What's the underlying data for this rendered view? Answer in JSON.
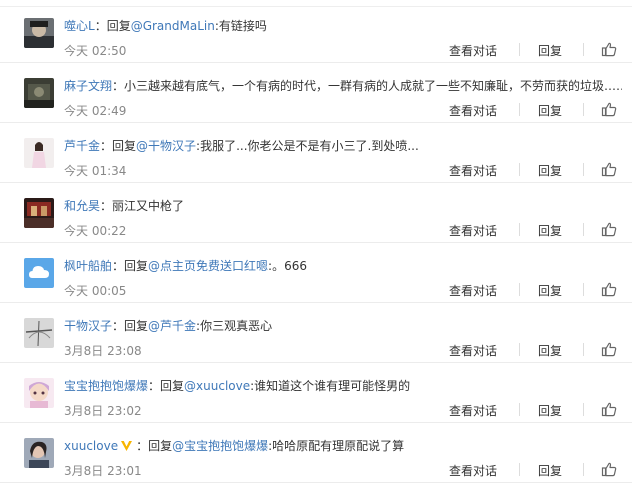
{
  "actions": {
    "view_conversation": "查看对话",
    "reply": "回复"
  },
  "comments": [
    {
      "user": "噬心L",
      "prefix": "：回复",
      "reply_to": "@GrandMaLin",
      "text": ":有链接吗",
      "time": "今天 02:50",
      "avatar": "dark-portrait-avatar"
    },
    {
      "user": "麻子文翔",
      "prefix": "",
      "reply_to": "",
      "text": "：小三越来越有底气，一个有病的时代，一群有病的人成就了一些不知廉耻，不劳而获的垃圾……",
      "time": "今天 02:49",
      "avatar": "dark-scene-avatar"
    },
    {
      "user": "芦千金",
      "prefix": "：回复",
      "reply_to": "@干物汉子",
      "text": ":我服了...你老公是不是有小三了.到处喷...",
      "time": "今天 01:34",
      "avatar": "girl-portrait-avatar"
    },
    {
      "user": "和允昊",
      "prefix": "",
      "reply_to": "",
      "text": "：丽江又中枪了",
      "time": "今天 00:22",
      "avatar": "red-scene-avatar"
    },
    {
      "user": "枫叶船舶",
      "prefix": "：回复",
      "reply_to": "@点主页免费送口红嗯",
      "text": ":。666",
      "time": "今天 00:05",
      "avatar": "default-cloud-avatar"
    },
    {
      "user": "干物汉子",
      "prefix": "：回复",
      "reply_to": "@芦千金",
      "text": ":你三观真恶心",
      "time": "3月8日 23:08",
      "avatar": "gray-sketch-avatar"
    },
    {
      "user": "宝宝抱抱饱爆爆",
      "prefix": "：回复",
      "reply_to": "@xuuclove",
      "text": ":谁知道这个谁有理可能怪男的",
      "time": "3月8日 23:02",
      "avatar": "cartoon-girl-avatar"
    },
    {
      "user": "xuuclove",
      "prefix": "：回复",
      "reply_to": "@宝宝抱抱饱爆爆",
      "text": ":哈哈原配有理原配说了算",
      "time": "3月8日 23:01",
      "avatar": "photo-girl-avatar",
      "vip": true
    }
  ],
  "colors": {
    "link": "#3f78b8",
    "time": "#888888",
    "divider": "#ececec"
  }
}
